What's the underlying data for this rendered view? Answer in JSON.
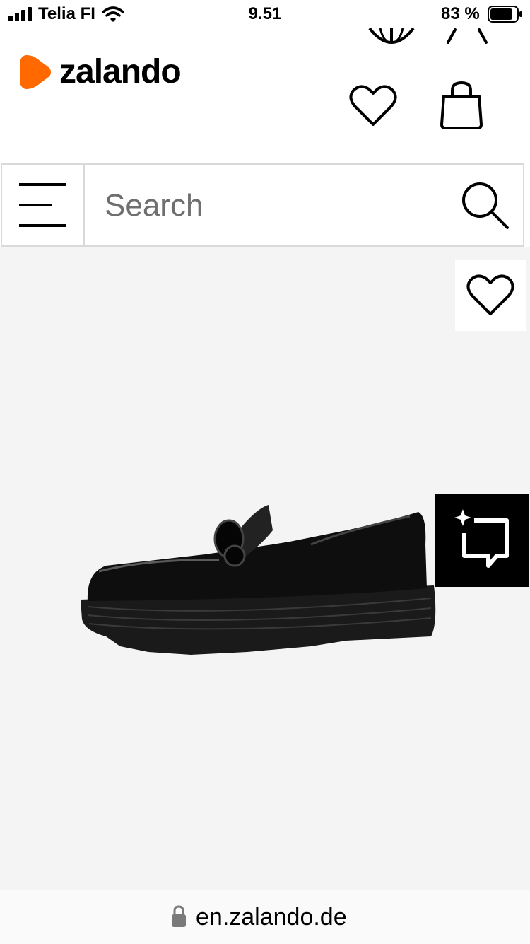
{
  "status_bar": {
    "carrier": "Telia FI",
    "time": "9.51",
    "battery": "83 %"
  },
  "header": {
    "brand": "zalando",
    "brand_color": "#ff6900"
  },
  "search": {
    "placeholder": "Search"
  },
  "browser": {
    "url": "en.zalando.de"
  },
  "icons": [
    "globe-icon",
    "user-icon",
    "heart-icon",
    "bag-icon",
    "menu-icon",
    "search-icon",
    "ai-assistant-icon",
    "lock-icon"
  ]
}
